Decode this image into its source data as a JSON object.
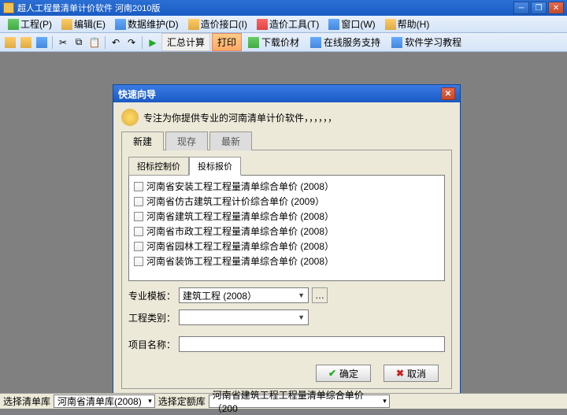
{
  "app": {
    "title": "超人工程量清单计价软件 河南2010版"
  },
  "menu": {
    "items": [
      {
        "label": "工程(P)"
      },
      {
        "label": "编辑(E)"
      },
      {
        "label": "数据维护(D)"
      },
      {
        "label": "造价接口(I)"
      },
      {
        "label": "造价工具(T)"
      },
      {
        "label": "窗口(W)"
      },
      {
        "label": "帮助(H)"
      }
    ]
  },
  "toolbar": {
    "calc": "汇总计算",
    "print": "打印",
    "download": "下载价材",
    "online": "在线服务支持",
    "tutorial": "软件学习教程"
  },
  "dialog": {
    "title": "快速向导",
    "hint": "专注为你提供专业的河南清单计价软件，，，，，，",
    "tabs1": {
      "new": "新建",
      "existing": "现存",
      "recent": "最新"
    },
    "tabs2": {
      "control": "招标控制价",
      "bid": "投标报价"
    },
    "list": [
      "河南省安装工程工程量清单综合单价 (2008）",
      "河南省仿古建筑工程计价综合单价 (2009）",
      "河南省建筑工程工程量清单综合单价 (2008）",
      "河南省市政工程工程量清单综合单价 (2008）",
      "河南省园林工程工程量清单综合单价 (2008）",
      "河南省装饰工程工程量清单综合单价 (2008）"
    ],
    "form": {
      "template_label": "专业模板：",
      "template_value": "建筑工程 (2008）",
      "category_label": "工程类别：",
      "category_value": "",
      "name_label": "项目名称："
    },
    "buttons": {
      "ok": "确定",
      "cancel": "取消"
    }
  },
  "statusbar": {
    "list_label": "选择清单库",
    "list_value": "河南省清单库(2008)",
    "quota_label": "选择定额库",
    "quota_value": "河南省建筑工程工程量清单综合单价（200"
  }
}
